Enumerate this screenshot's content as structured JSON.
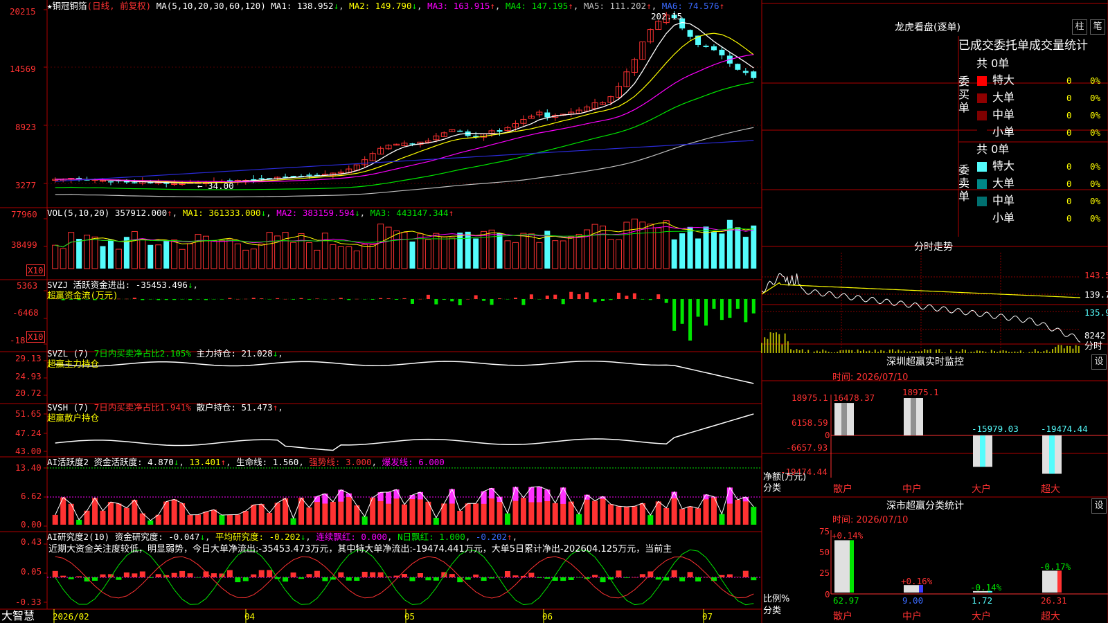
{
  "app": {
    "brand": "大智慧",
    "stock_name": "铜冠铜箔",
    "period_label": "(日线, 前复权)"
  },
  "colors": {
    "up": "#ff3232",
    "down": "#54fcfc",
    "grid": "#b00000",
    "ma1": "#ffffff",
    "ma2": "#ffff00",
    "ma3": "#ff00ff",
    "ma4": "#00e600",
    "ma5": "#c0c0c0",
    "ma6": "#2a2ad8"
  },
  "panes": {
    "price": {
      "ticks": [
        "20215",
        "14569",
        "8923",
        "3277"
      ],
      "legend": {
        "ma_params": "MA(5,10,20,30,60,120)",
        "ma1": "MA1: 138.952",
        "ma2": "MA2: 149.790",
        "ma3": "MA3: 163.915",
        "ma4": "MA4: 147.195",
        "ma5": "MA5: 111.202",
        "ma6": "MA6: 74.576"
      },
      "high_label": "202.15",
      "low_label": "← 34.00"
    },
    "volume": {
      "ticks": [
        "77960",
        "38499"
      ],
      "scale": "X10",
      "legend": {
        "name": "VOL(5,10,20)",
        "val": "357912.000",
        "ma1": "MA1: 361333.000",
        "ma2": "MA2: 383159.594",
        "ma3": "MA3: 443147.344"
      }
    },
    "svzj": {
      "ticks": [
        "5363",
        "-6468",
        "-18"
      ],
      "scale": "X10",
      "legend": {
        "name": "SVZJ",
        "desc": "活跃资金进出: -35453.496",
        "sub": "超赢资金流(万元)"
      }
    },
    "svzl": {
      "ticks": [
        "29.13",
        "24.93",
        "20.72"
      ],
      "legend": {
        "name": "SVZL (7)",
        "ratio": "7日内买卖净占比2.105%",
        "hold": "主力持仓: 21.028",
        "sub": "超赢主力持仓"
      }
    },
    "svsh": {
      "ticks": [
        "51.65",
        "47.24",
        "43.00"
      ],
      "legend": {
        "name": "SVSH (7)",
        "ratio": "7日内买卖净占比1.941%",
        "hold": "散户持仓: 51.473",
        "sub": "超赢散户持仓"
      }
    },
    "ai1": {
      "ticks": [
        "13.40",
        "6.62",
        "0.00"
      ],
      "legend": {
        "name": "AI活跃度2",
        "a": "资金活跃度: 4.870",
        "b": "13.401",
        "c": "生命线: 1.560",
        "d": "强势线: 3.000",
        "e": "爆发线: 6.000"
      }
    },
    "ai2": {
      "ticks": [
        "0.43",
        "0.05",
        "-0.33"
      ],
      "legend": {
        "name": "AI研究度2(10)",
        "a": "资金研究度: -0.047",
        "b": "平均研究度: -0.202",
        "c": "连续飘红: 0.000",
        "d": "N日飘红: 1.000",
        "e": "-0.202"
      },
      "commentary": "近期大资金关注度较低，明显弱势，今日大单净流出:-35453.473万元，其中特大单净流出:-19474.441万元，大单5日累计净出-202604.125万元，当前主"
    }
  },
  "time_axis": [
    "2026/02",
    "04",
    "05",
    "06",
    "07"
  ],
  "longhu": {
    "title": "龙虎看盘(逐单)",
    "tab_zhu": "柱",
    "tab_bi": "笔",
    "header": "已成交委托单成交量统计",
    "buy": {
      "label": "委买单",
      "total": "共 0单",
      "rows": [
        {
          "name": "特大",
          "val": "0",
          "pct": "0%"
        },
        {
          "name": "大单",
          "val": "0",
          "pct": "0%"
        },
        {
          "name": "中单",
          "val": "0",
          "pct": "0%"
        },
        {
          "name": "小单",
          "val": "0",
          "pct": "0%"
        }
      ]
    },
    "sell": {
      "label": "委卖单",
      "total": "共 0单",
      "rows": [
        {
          "name": "特大",
          "val": "0",
          "pct": "0%"
        },
        {
          "name": "大单",
          "val": "0",
          "pct": "0%"
        },
        {
          "name": "中单",
          "val": "0",
          "pct": "0%"
        },
        {
          "name": "小单",
          "val": "0",
          "pct": "0%"
        }
      ]
    }
  },
  "intraday": {
    "title": "分时走势",
    "ticks": [
      "143.5",
      "139.7",
      "135.9",
      "8242"
    ],
    "vol_label": "分时"
  },
  "sz_monitor": {
    "title": "深圳超赢实时监控",
    "settings": "设",
    "date": "时间: 2026/07/10",
    "ticks": [
      "18975.1",
      "6158.59",
      "0",
      "-6657.93",
      "-19474.44"
    ],
    "ylabel": "净额(万元)",
    "xlabel": "分类",
    "bar_labels": [
      "16478.37",
      "18975.1",
      "-15979.03",
      "-19474.44"
    ],
    "categories": [
      "散户",
      "中户",
      "大户",
      "超大"
    ]
  },
  "sz_class": {
    "title": "深市超赢分类统计",
    "settings": "设",
    "date": "时间: 2026/07/10",
    "ticks": [
      "75",
      "50",
      "25",
      "0"
    ],
    "ylabel": "比例%",
    "xlabel": "分类",
    "top_labels": [
      "+0.14%",
      "+0.16%",
      "-0.14%",
      "-0.17%"
    ],
    "bottom_labels": [
      "62.97",
      "9.00",
      "1.72",
      "26.31"
    ],
    "categories": [
      "散户",
      "中户",
      "大户",
      "超大"
    ]
  },
  "chart_data": [
    {
      "type": "bar",
      "title": "深圳超赢实时监控",
      "xlabel": "分类",
      "ylabel": "净额(万元)",
      "categories": [
        "散户",
        "中户",
        "大户",
        "超大"
      ],
      "values": [
        16478.37,
        18975.1,
        -15979.03,
        -19474.44
      ],
      "ylim": [
        -19474.44,
        18975.1
      ]
    },
    {
      "type": "bar",
      "title": "深市超赢分类统计",
      "xlabel": "分类",
      "ylabel": "比例%",
      "categories": [
        "散户",
        "中户",
        "大户",
        "超大"
      ],
      "values": [
        62.97,
        9.0,
        1.72,
        26.31
      ],
      "changes": [
        "+0.14%",
        "+0.16%",
        "-0.14%",
        "-0.17%"
      ],
      "ylim": [
        0,
        75
      ]
    },
    {
      "type": "line",
      "title": "铜冠铜箔",
      "x": [
        "2026/02",
        "04",
        "05",
        "06",
        "07"
      ],
      "series": [
        {
          "name": "MA1",
          "last": 138.952
        },
        {
          "name": "MA2",
          "last": 149.79
        },
        {
          "name": "MA3",
          "last": 163.915
        },
        {
          "name": "MA4",
          "last": 147.195
        },
        {
          "name": "MA5",
          "last": 111.202
        },
        {
          "name": "MA6",
          "last": 74.576
        }
      ],
      "price_high": 202.15,
      "price_low": 34.0,
      "close_path": [
        38,
        38,
        39,
        37,
        37,
        38,
        37,
        36,
        36,
        35,
        35,
        36,
        35,
        35,
        34,
        34,
        34,
        35,
        35,
        35,
        36,
        36,
        36,
        37,
        37,
        38,
        39,
        39,
        40,
        40,
        41,
        41,
        42,
        42,
        43,
        44,
        45,
        48,
        52,
        57,
        63,
        68,
        71,
        72,
        73,
        72,
        74,
        75,
        80,
        83,
        86,
        84,
        80,
        79,
        82,
        85,
        84,
        88,
        92,
        96,
        99,
        103,
        98,
        100,
        101,
        103,
        105,
        108,
        112,
        112,
        118,
        128,
        142,
        154,
        171,
        183,
        191,
        197,
        194,
        184,
        176,
        168,
        166,
        163,
        158,
        150,
        144,
        141,
        136
      ]
    }
  ]
}
